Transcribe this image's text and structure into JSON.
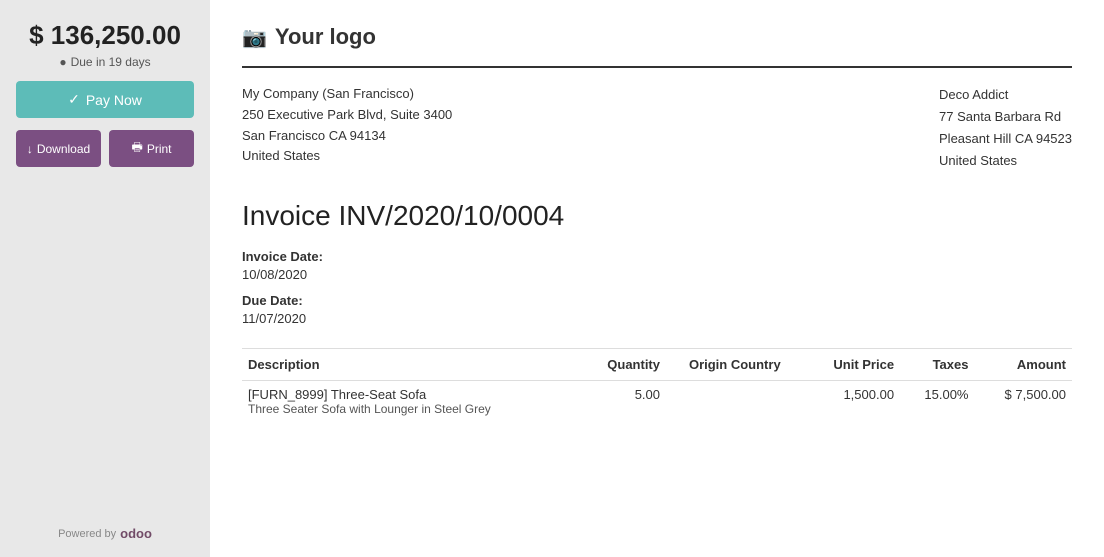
{
  "sidebar": {
    "amount": "$ 136,250.00",
    "due_label": "Due in 19 days",
    "pay_now_label": "Pay Now",
    "download_label": "Download",
    "print_label": "Print",
    "powered_by": "Powered by",
    "odoo": "odoo"
  },
  "company": {
    "logo_text": "Your logo",
    "name": "My Company (San Francisco)",
    "address_line1": "250 Executive Park Blvd, Suite 3400",
    "address_line2": "San Francisco CA 94134",
    "country": "United States"
  },
  "billing": {
    "name": "Deco Addict",
    "address_line1": "77 Santa Barbara Rd",
    "address_line2": "Pleasant Hill CA 94523",
    "country": "United States"
  },
  "invoice": {
    "title": "Invoice INV/2020/10/0004",
    "date_label": "Invoice Date:",
    "date_value": "10/08/2020",
    "due_label": "Due Date:",
    "due_value": "11/07/2020"
  },
  "table": {
    "headers": {
      "description": "Description",
      "quantity": "Quantity",
      "origin_country_group": "Origin Country",
      "unit_price": "Unit Price",
      "taxes": "Taxes",
      "amount": "Amount"
    },
    "rows": [
      {
        "description": "[FURN_8999] Three-Seat Sofa",
        "description_sub": "Three Seater Sofa with Lounger in Steel Grey",
        "quantity": "5.00",
        "origin_country": "",
        "unit_price": "1,500.00",
        "taxes": "15.00%",
        "amount": "$ 7,500.00"
      }
    ]
  }
}
